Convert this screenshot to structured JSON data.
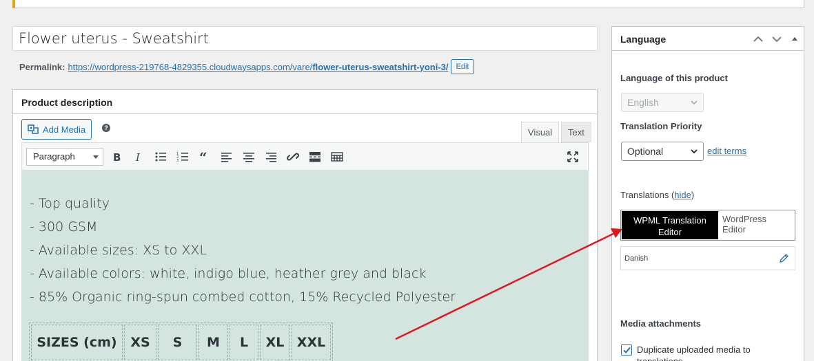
{
  "post": {
    "title": "Flower uterus - Sweatshirt",
    "permalink_label": "Permalink:",
    "permalink_base": "https://wordpress-219768-4829355.cloudwaysapps.com/vare/",
    "permalink_slug": "flower-uterus-sweatshirt-yoni-3/",
    "edit_label": "Edit"
  },
  "description_box": {
    "title": "Product description",
    "add_media_label": "Add Media",
    "help_icon": "question-icon",
    "tabs": [
      "Visual",
      "Text"
    ],
    "format_select": "Paragraph",
    "toolbar_icons": [
      "bold-icon",
      "italic-icon",
      "bullet-list-icon",
      "numbered-list-icon",
      "blockquote-icon",
      "align-left-icon",
      "align-center-icon",
      "align-right-icon",
      "link-icon",
      "read-more-icon",
      "toolbar-toggle-icon",
      "fullscreen-icon"
    ],
    "content_lines": [
      "- Top quality",
      "- 300 GSM",
      "- Available sizes: XS to XXL",
      "- Available colors: white, indigo blue, heather grey and black",
      "- 85% Organic ring-spun combed cotton, 15% Recycled Polyester"
    ],
    "size_table_headers": [
      "SIZES  (cm)",
      "XS",
      "S",
      "M",
      "L",
      "XL",
      "XXL"
    ]
  },
  "language_box": {
    "title": "Language",
    "language_label": "Language of this product",
    "language_value": "English",
    "priority_label": "Translation Priority",
    "priority_value": "Optional",
    "edit_terms_label": "edit terms",
    "translations_label": "Translations (",
    "translations_hide": "hide",
    "translations_close": ")",
    "editor_options": [
      "WPML Translation Editor",
      "WordPress Editor"
    ],
    "selected_editor": "WPML Translation Editor",
    "translation_language": "Danish",
    "media_label": "Media attachments",
    "duplicate_media_label": "Duplicate uploaded media to translations",
    "duplicate_media_checked": true
  },
  "colors": {
    "accent": "#2271b1",
    "notice_border": "#dba617",
    "editor_bg": "#d4e5df",
    "annotation_arrow": "#e0181e"
  }
}
